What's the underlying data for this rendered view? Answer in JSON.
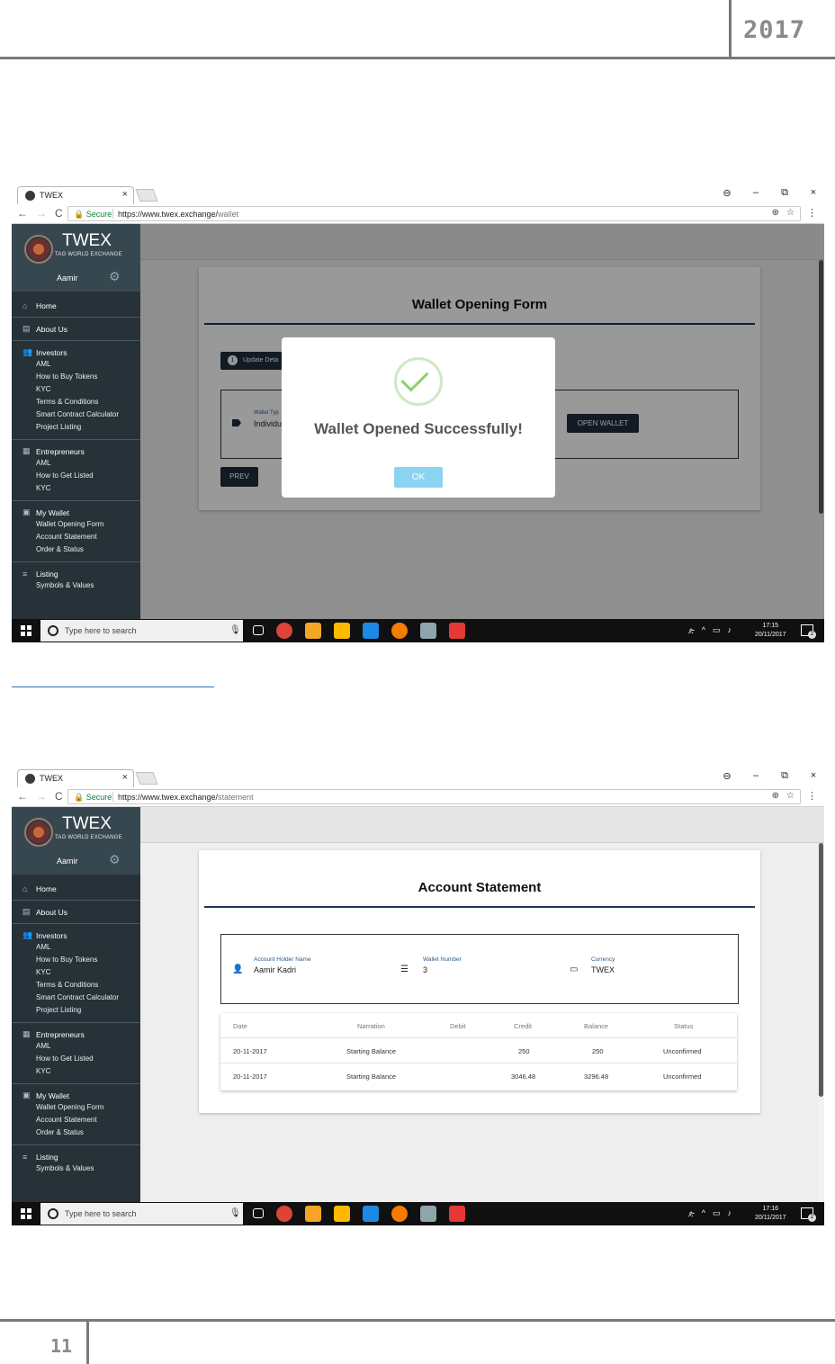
{
  "doc": {
    "year": "2017",
    "page_number": "11"
  },
  "browser": {
    "tab_title": "TWEX",
    "tab_close": "×",
    "secure_label": "Secure",
    "url_base": "https://www.twex.exchange/",
    "window_controls": [
      "⊖",
      "–",
      "⧉",
      "×"
    ]
  },
  "sidebar": {
    "brand": "TWEX",
    "brand_sub": "TAG WORLD EXCHANGE",
    "user": "Aamir",
    "sections": [
      {
        "head": "Home",
        "icon": "home-icon",
        "items": []
      },
      {
        "head": "About Us",
        "icon": "document-icon",
        "items": []
      },
      {
        "head": "Investors",
        "icon": "people-icon",
        "items": [
          "AML",
          "How to Buy Tokens",
          "KYC",
          "Terms & Conditions",
          "Smart Contract Calculator",
          "Project Listing"
        ]
      },
      {
        "head": "Entrepreneurs",
        "icon": "clipboard-icon",
        "items": [
          "AML",
          "How to Get Listed",
          "KYC"
        ]
      },
      {
        "head": "My Wallet",
        "icon": "wallet-icon",
        "items": [
          "Wallet Opening Form",
          "Account Statement",
          "Order & Status"
        ]
      },
      {
        "head": "Listing",
        "icon": "list-icon",
        "items": [
          "Symbols & Values"
        ]
      }
    ]
  },
  "shot1": {
    "url_path": "wallet",
    "card_title": "Wallet Opening Form",
    "step_num": "1",
    "step_label": "Update Deta",
    "wallet_type_label": "Wallet Typ",
    "wallet_type_value": "Individu",
    "open_wallet": "OPEN WALLET",
    "prev": "PREV",
    "modal_title": "Wallet Opened Successfully!",
    "ok": "OK",
    "clock_time": "17:15",
    "clock_date": "20/11/2017"
  },
  "shot2": {
    "url_path": "statement",
    "card_title": "Account Statement",
    "account_holder_label": "Account Holder Name",
    "account_holder_value": "Aamir Kadri",
    "wallet_number_label": "Wallet Number",
    "wallet_number_value": "3",
    "currency_label": "Currency",
    "currency_value": "TWEX",
    "table": {
      "headers": [
        "Date",
        "Narration",
        "Debit",
        "Credit",
        "Balance",
        "Status"
      ],
      "rows": [
        [
          "20-11-2017",
          "Starting Balance",
          "",
          "250",
          "250",
          "Unconfirmed"
        ],
        [
          "20-11-2017",
          "Starting Balance",
          "",
          "3046.48",
          "3296.48",
          "Unconfirmed"
        ]
      ]
    },
    "clock_time": "17:16",
    "clock_date": "20/11/2017"
  },
  "taskbar": {
    "search_placeholder": "Type here to search",
    "notif_count": "2",
    "icon_colors": [
      "#db4437",
      "#f4a523",
      "#ffb900",
      "#1e88e5",
      "#f57c00",
      "#90a4ae",
      "#e53935"
    ]
  }
}
